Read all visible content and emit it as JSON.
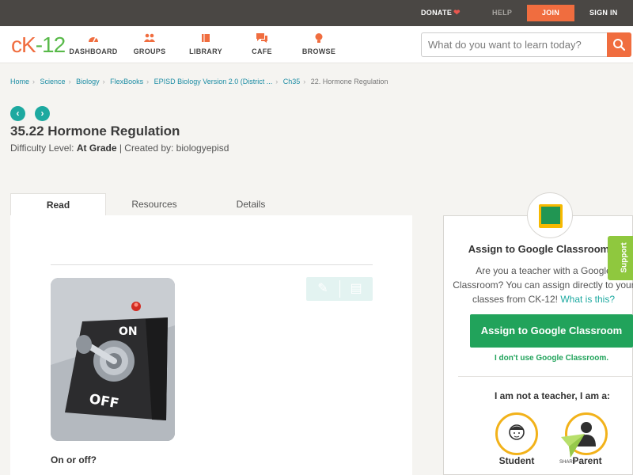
{
  "topbar": {
    "donate": "DONATE",
    "help": "HELP",
    "join": "JOIN",
    "signin": "SIGN IN"
  },
  "logo": {
    "ck": "cK",
    "dash": "-",
    "num": "12"
  },
  "nav": [
    {
      "label": "DASHBOARD",
      "icon": "dashboard-icon"
    },
    {
      "label": "GROUPS",
      "icon": "groups-icon"
    },
    {
      "label": "LIBRARY",
      "icon": "library-icon"
    },
    {
      "label": "CAFE",
      "icon": "cafe-icon"
    },
    {
      "label": "BROWSE",
      "icon": "browse-icon"
    }
  ],
  "search": {
    "placeholder": "What do you want to learn today?",
    "value": ""
  },
  "breadcrumb": [
    "Home",
    "Science",
    "Biology",
    "FlexBooks",
    "EPISD Biology Version 2.0 (District ...",
    "Ch35",
    "22. Hormone Regulation"
  ],
  "page": {
    "title": "35.22 Hormone Regulation",
    "difficulty_label": "Difficulty Level:",
    "difficulty_value": "At Grade",
    "created_by": "| Created by: biologyepisd"
  },
  "tabs": [
    "Read",
    "Resources",
    "Details"
  ],
  "content": {
    "photo_on": "ON",
    "photo_off": "OFF",
    "caption": "On or off?"
  },
  "google_classroom": {
    "title": "Assign to Google Classroom",
    "text_1": "Are you a teacher with a Google",
    "text_2": "Classroom? You can assign directly to your",
    "text_3": "classes from CK-12!",
    "what_link": "What is this?",
    "assign_button": "Assign to Google Classroom",
    "dont_use": "I don't use Google Classroom.",
    "not_teacher": "I am not a teacher, I am a:",
    "student": "Student",
    "parent": "Parent"
  },
  "support": "Support",
  "share": "SHARE",
  "colors": {
    "accent": "#f06d3f",
    "teal": "#1da9a0",
    "green": "#21a35b",
    "topbar": "#4a4744"
  }
}
